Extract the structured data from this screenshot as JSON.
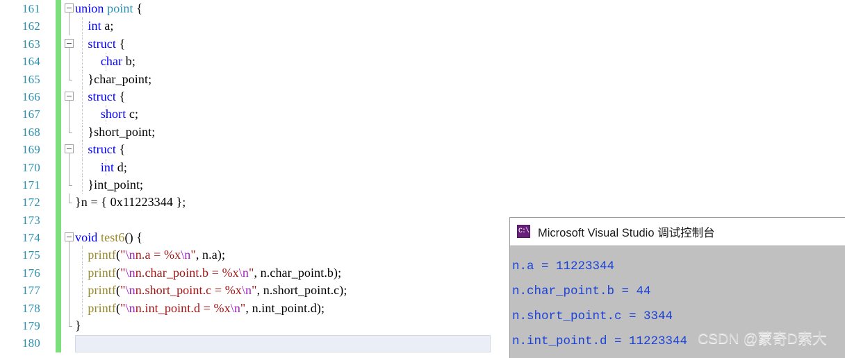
{
  "editor": {
    "language": "c",
    "first_line": 161,
    "current_line": 180,
    "colors": {
      "keyword": "#0000ff",
      "type": "#2b91af",
      "function": "#9b8a2b",
      "string": "#a31515",
      "escape": "#a020c0",
      "linenumber": "#2b91af",
      "changebar": "#7cdf7c",
      "currentline": "#eceef7",
      "background": "#ffffff"
    },
    "lines": [
      {
        "no": "161",
        "fold": "open",
        "guides": [],
        "indent": 0,
        "tokens": [
          {
            "t": "union",
            "c": "kw"
          },
          {
            "t": " ",
            "c": "pl"
          },
          {
            "t": "point",
            "c": "type"
          },
          {
            "t": " {",
            "c": "pl"
          }
        ]
      },
      {
        "no": "162",
        "fold": "line",
        "guides": [
          "g1"
        ],
        "indent": 1,
        "tokens": [
          {
            "t": "    ",
            "c": "pl"
          },
          {
            "t": "int",
            "c": "kw"
          },
          {
            "t": " a;",
            "c": "pl"
          }
        ]
      },
      {
        "no": "163",
        "fold": "open",
        "guides": [
          "g1"
        ],
        "indent": 1,
        "tokens": [
          {
            "t": "    ",
            "c": "pl"
          },
          {
            "t": "struct",
            "c": "kw"
          },
          {
            "t": " {",
            "c": "pl"
          }
        ]
      },
      {
        "no": "164",
        "fold": "line",
        "guides": [
          "g1",
          "g2"
        ],
        "indent": 2,
        "tokens": [
          {
            "t": "        ",
            "c": "pl"
          },
          {
            "t": "char",
            "c": "kw"
          },
          {
            "t": " b;",
            "c": "pl"
          }
        ]
      },
      {
        "no": "165",
        "fold": "end",
        "guides": [
          "g1"
        ],
        "indent": 1,
        "tokens": [
          {
            "t": "    }char_point;",
            "c": "pl"
          }
        ]
      },
      {
        "no": "166",
        "fold": "open",
        "guides": [
          "g1"
        ],
        "indent": 1,
        "tokens": [
          {
            "t": "    ",
            "c": "pl"
          },
          {
            "t": "struct",
            "c": "kw"
          },
          {
            "t": " {",
            "c": "pl"
          }
        ]
      },
      {
        "no": "167",
        "fold": "line",
        "guides": [
          "g1",
          "g2"
        ],
        "indent": 2,
        "tokens": [
          {
            "t": "        ",
            "c": "pl"
          },
          {
            "t": "short",
            "c": "kw"
          },
          {
            "t": " c;",
            "c": "pl"
          }
        ]
      },
      {
        "no": "168",
        "fold": "end",
        "guides": [
          "g1"
        ],
        "indent": 1,
        "tokens": [
          {
            "t": "    }short_point;",
            "c": "pl"
          }
        ]
      },
      {
        "no": "169",
        "fold": "open",
        "guides": [
          "g1"
        ],
        "indent": 1,
        "tokens": [
          {
            "t": "    ",
            "c": "pl"
          },
          {
            "t": "struct",
            "c": "kw"
          },
          {
            "t": " {",
            "c": "pl"
          }
        ]
      },
      {
        "no": "170",
        "fold": "line",
        "guides": [
          "g1",
          "g2"
        ],
        "indent": 2,
        "tokens": [
          {
            "t": "        ",
            "c": "pl"
          },
          {
            "t": "int",
            "c": "kw"
          },
          {
            "t": " d;",
            "c": "pl"
          }
        ]
      },
      {
        "no": "171",
        "fold": "end",
        "guides": [
          "g1"
        ],
        "indent": 1,
        "tokens": [
          {
            "t": "    }int_point;",
            "c": "pl"
          }
        ]
      },
      {
        "no": "172",
        "fold": "close",
        "guides": [],
        "indent": 0,
        "tokens": [
          {
            "t": "}n = { 0x11223344 };",
            "c": "pl"
          }
        ]
      },
      {
        "no": "173",
        "fold": "none",
        "guides": [],
        "indent": 0,
        "tokens": []
      },
      {
        "no": "174",
        "fold": "open",
        "guides": [],
        "indent": 0,
        "tokens": [
          {
            "t": "void",
            "c": "kw"
          },
          {
            "t": " ",
            "c": "pl"
          },
          {
            "t": "test6",
            "c": "fn"
          },
          {
            "t": "() {",
            "c": "pl"
          }
        ]
      },
      {
        "no": "175",
        "fold": "line",
        "guides": [
          "g1"
        ],
        "indent": 1,
        "tokens": [
          {
            "t": "    ",
            "c": "pl"
          },
          {
            "t": "printf",
            "c": "fn"
          },
          {
            "t": "(",
            "c": "pl"
          },
          {
            "t": "\"",
            "c": "str"
          },
          {
            "t": "\\n",
            "c": "esc"
          },
          {
            "t": "n.a = %x",
            "c": "str"
          },
          {
            "t": "\\n",
            "c": "esc"
          },
          {
            "t": "\"",
            "c": "str"
          },
          {
            "t": ", n.a);",
            "c": "pl"
          }
        ]
      },
      {
        "no": "176",
        "fold": "line",
        "guides": [
          "g1"
        ],
        "indent": 1,
        "tokens": [
          {
            "t": "    ",
            "c": "pl"
          },
          {
            "t": "printf",
            "c": "fn"
          },
          {
            "t": "(",
            "c": "pl"
          },
          {
            "t": "\"",
            "c": "str"
          },
          {
            "t": "\\n",
            "c": "esc"
          },
          {
            "t": "n.char_point.b = %x",
            "c": "str"
          },
          {
            "t": "\\n",
            "c": "esc"
          },
          {
            "t": "\"",
            "c": "str"
          },
          {
            "t": ", n.char_point.b);",
            "c": "pl"
          }
        ]
      },
      {
        "no": "177",
        "fold": "line",
        "guides": [
          "g1"
        ],
        "indent": 1,
        "tokens": [
          {
            "t": "    ",
            "c": "pl"
          },
          {
            "t": "printf",
            "c": "fn"
          },
          {
            "t": "(",
            "c": "pl"
          },
          {
            "t": "\"",
            "c": "str"
          },
          {
            "t": "\\n",
            "c": "esc"
          },
          {
            "t": "n.short_point.c = %x",
            "c": "str"
          },
          {
            "t": "\\n",
            "c": "esc"
          },
          {
            "t": "\"",
            "c": "str"
          },
          {
            "t": ", n.short_point.c);",
            "c": "pl"
          }
        ]
      },
      {
        "no": "178",
        "fold": "line",
        "guides": [
          "g1"
        ],
        "indent": 1,
        "tokens": [
          {
            "t": "    ",
            "c": "pl"
          },
          {
            "t": "printf",
            "c": "fn"
          },
          {
            "t": "(",
            "c": "pl"
          },
          {
            "t": "\"",
            "c": "str"
          },
          {
            "t": "\\n",
            "c": "esc"
          },
          {
            "t": "n.int_point.d = %x",
            "c": "str"
          },
          {
            "t": "\\n",
            "c": "esc"
          },
          {
            "t": "\"",
            "c": "str"
          },
          {
            "t": ", n.int_point.d);",
            "c": "pl"
          }
        ]
      },
      {
        "no": "179",
        "fold": "close",
        "guides": [],
        "indent": 0,
        "tokens": [
          {
            "t": "}",
            "c": "pl"
          }
        ]
      },
      {
        "no": "180",
        "fold": "none",
        "guides": [],
        "indent": 0,
        "tokens": []
      }
    ]
  },
  "console": {
    "icon": "cmd-prompt-icon",
    "icon_glyph": "C:\\",
    "title": "Microsoft Visual Studio 调试控制台",
    "output_lines": [
      "n.a = 11223344",
      "n.char_point.b = 44",
      "n.short_point.c = 3344",
      "n.int_point.d = 11223344"
    ],
    "text_color": "#1b42d8",
    "background": "#c0c0c0"
  },
  "watermark": {
    "text": "CSDN @蒙奇D索大"
  }
}
